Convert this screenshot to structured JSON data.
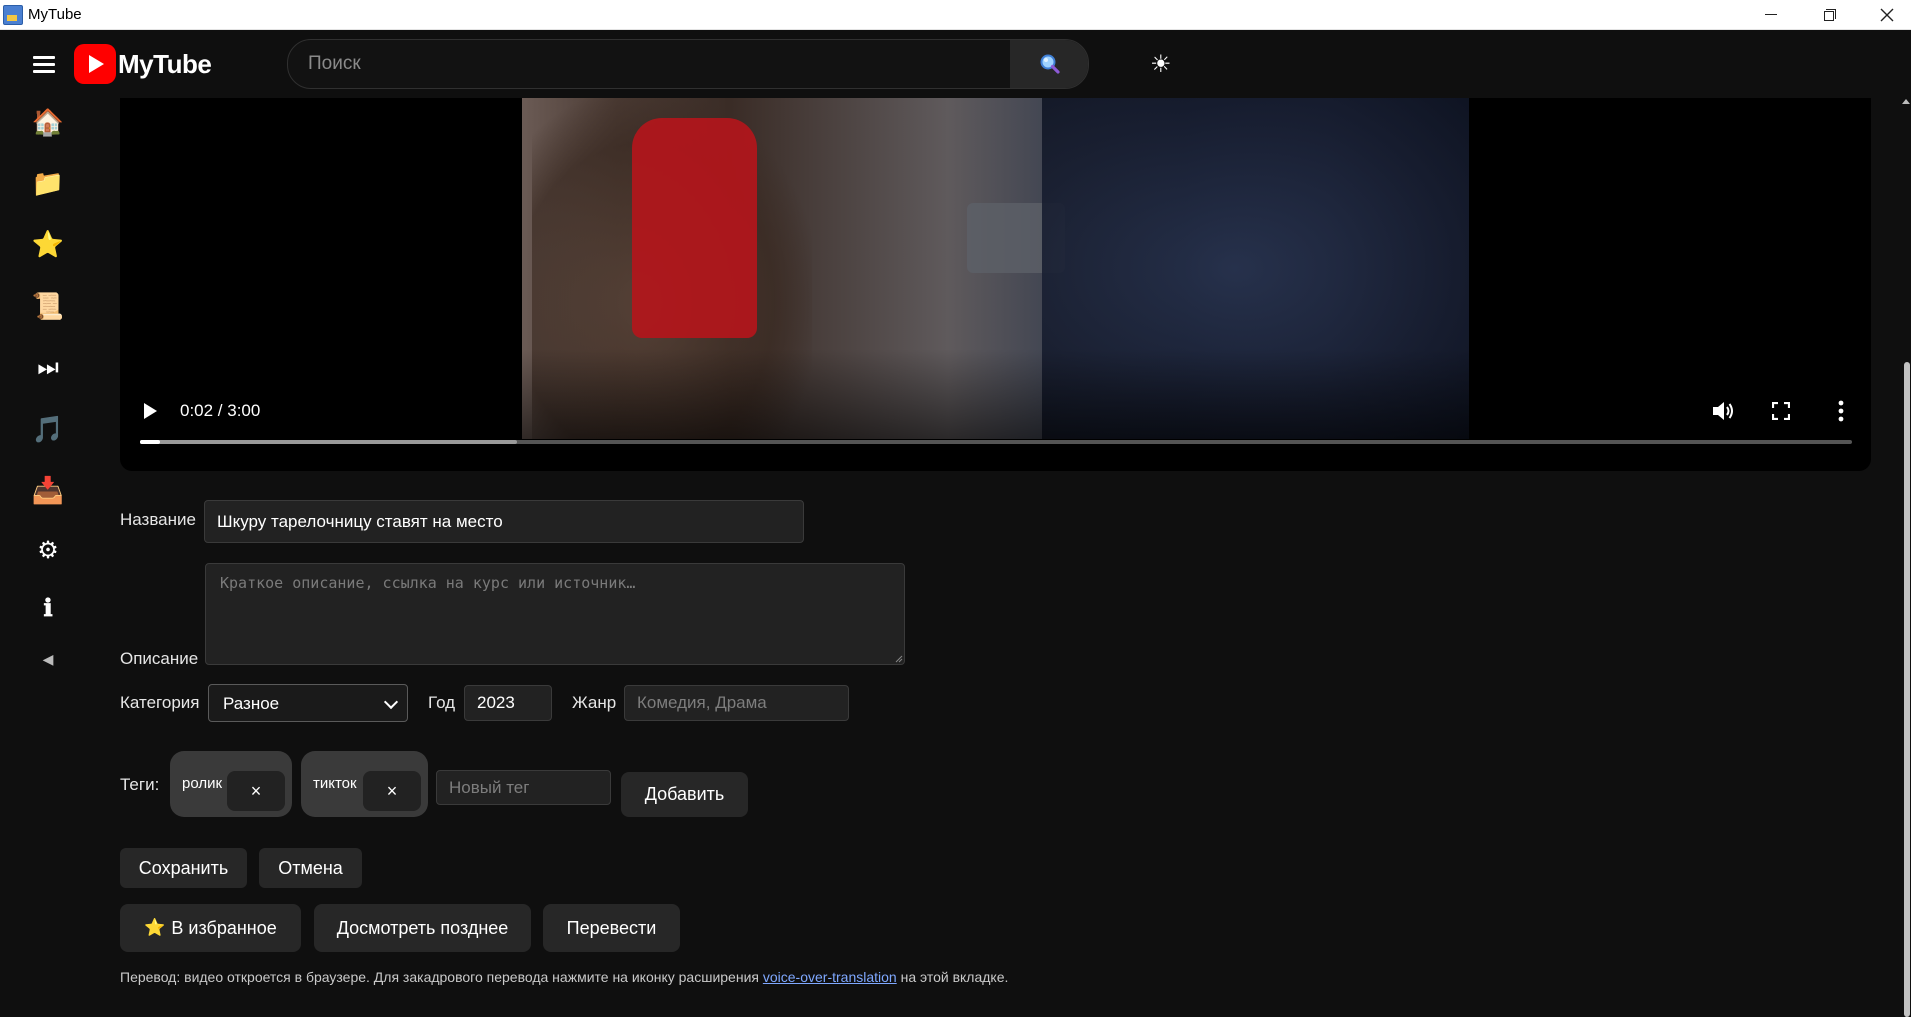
{
  "window": {
    "title": "MyTube"
  },
  "header": {
    "logo_text": "MyTube",
    "search_placeholder": "Поиск",
    "search_icon": "magnifier-icon",
    "theme_icon": "☀"
  },
  "sidebar": {
    "items": [
      {
        "name": "home",
        "icon": "🏠"
      },
      {
        "name": "folder",
        "icon": "📁"
      },
      {
        "name": "favorites",
        "icon": "⭐"
      },
      {
        "name": "history",
        "icon": "📜"
      },
      {
        "name": "watch-later",
        "icon": "⏭"
      },
      {
        "name": "music",
        "icon": "🎵"
      },
      {
        "name": "downloads",
        "icon": "📥"
      },
      {
        "name": "settings",
        "icon": "⚙"
      },
      {
        "name": "info",
        "icon": "ℹ"
      },
      {
        "name": "collapse",
        "icon": "◀"
      }
    ]
  },
  "player": {
    "time": "0:02 / 3:00",
    "played_fraction": 0.011,
    "buffered_fraction": 0.22
  },
  "form": {
    "title_label": "Название",
    "title_value": "Шкуру тарелочницу ставят на место",
    "description_label": "Описание",
    "description_placeholder": "Краткое описание, ссылка на курс или источник…",
    "category_label": "Категория",
    "category_value": "Разное",
    "year_label": "Год",
    "year_value": "2023",
    "genre_label": "Жанр",
    "genre_placeholder": "Комедия, Драма",
    "tags_label": "Теги:",
    "tags": [
      {
        "text": "ролик",
        "remove": "×"
      },
      {
        "text": "тикток",
        "remove": "×"
      }
    ],
    "new_tag_placeholder": "Новый тег",
    "add_button": "Добавить",
    "save_button": "Сохранить",
    "cancel_button": "Отмена"
  },
  "actions": {
    "favorite_icon": "⭐",
    "favorite_button": "В избранное",
    "watch_later_button": "Досмотреть позднее",
    "translate_button": "Перевести"
  },
  "note": {
    "before": "Перевод: видео откроется в браузере. Для закадрового перевода нажмите на иконку расширения ",
    "link": "voice-over-translation",
    "after": " на этой вкладке."
  }
}
